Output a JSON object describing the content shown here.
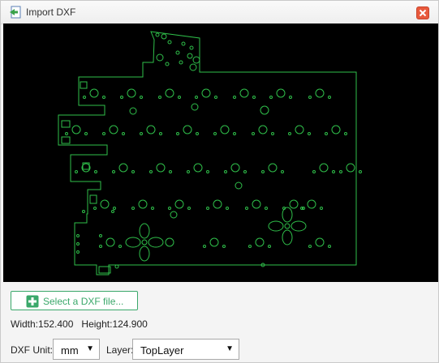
{
  "dialog": {
    "title": "Import DXF",
    "title_icon": "import-arrow-icon",
    "close_icon": "close-icon"
  },
  "preview": {
    "background": "#000000",
    "stroke_color": "#2fbf4a"
  },
  "select_file": {
    "label": "Select a DXF file...",
    "icon": "plus-icon",
    "color": "#3aa86a"
  },
  "dimensions": {
    "width_label": "Width:",
    "width_value": "152.400",
    "height_label": "Height:",
    "height_value": "124.900"
  },
  "options": {
    "unit_label": "DXF Unit:",
    "unit_value": "mm",
    "layer_label": "Layer:",
    "layer_value": "TopLayer"
  }
}
